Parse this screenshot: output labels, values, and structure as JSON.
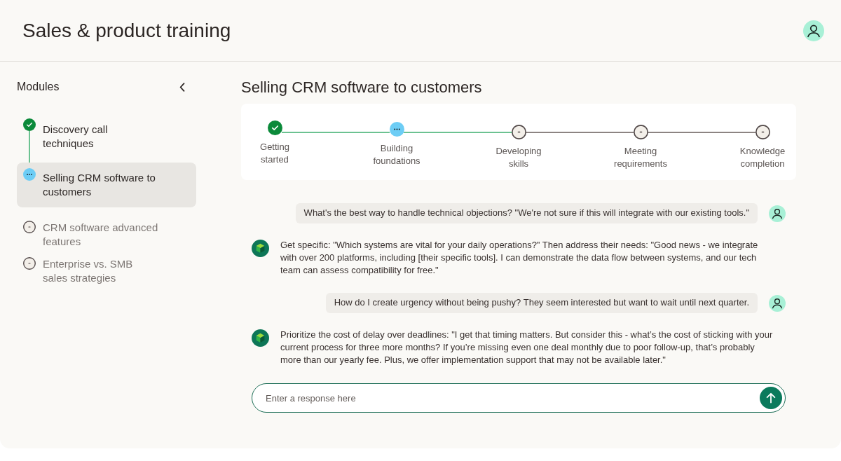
{
  "header": {
    "title": "Sales & product training"
  },
  "sidebar": {
    "title": "Modules",
    "modules": [
      {
        "label": "Discovery call techniques",
        "completed": true,
        "in_progress": false,
        "selected": false
      },
      {
        "label": "Selling CRM software to customers",
        "completed": false,
        "in_progress": true,
        "selected": true
      },
      {
        "label": "CRM software advanced features",
        "completed": false,
        "in_progress": false,
        "selected": false
      },
      {
        "label": "Enterprise vs. SMB sales strategies",
        "completed": false,
        "in_progress": false,
        "selected": false
      }
    ]
  },
  "lesson": {
    "title": "Selling CRM software to customers",
    "steps": [
      {
        "label": "Getting started",
        "completed": true,
        "in_progress": false
      },
      {
        "label": "Building foundations",
        "completed": false,
        "in_progress": true
      },
      {
        "label": "Developing skills",
        "completed": false,
        "in_progress": false
      },
      {
        "label": "Meeting requirements",
        "completed": false,
        "in_progress": false
      },
      {
        "label": "Knowledge completion",
        "completed": false,
        "in_progress": false
      }
    ]
  },
  "messages": [
    {
      "kind": "user",
      "text": "What's the best way to handle technical objections? \"We're not sure if this will integrate with our existing tools.\""
    },
    {
      "kind": "assistant",
      "text": "Get specific: \"Which systems are vital for your daily operations?\" Then address their needs: \"Good news - we integrate with over 200 platforms, including [their specific tools]. I can demonstrate the data flow between systems, and our tech team can assess compatibility for free.\""
    },
    {
      "kind": "user",
      "text": "How do I create urgency without being pushy? They seem interested but want to wait until next quarter."
    },
    {
      "kind": "assistant",
      "text": "Prioritize the cost of delay over deadlines: \"I get that timing matters. But consider this - what’s the cost of sticking with your current process for three more months? If you’re missing even one deal monthly due to poor follow-up, that’s probably more than our yearly fee. Plus, we offer implementation support that may not be available later.\""
    }
  ],
  "composer": {
    "placeholder": "Enter a response here"
  }
}
